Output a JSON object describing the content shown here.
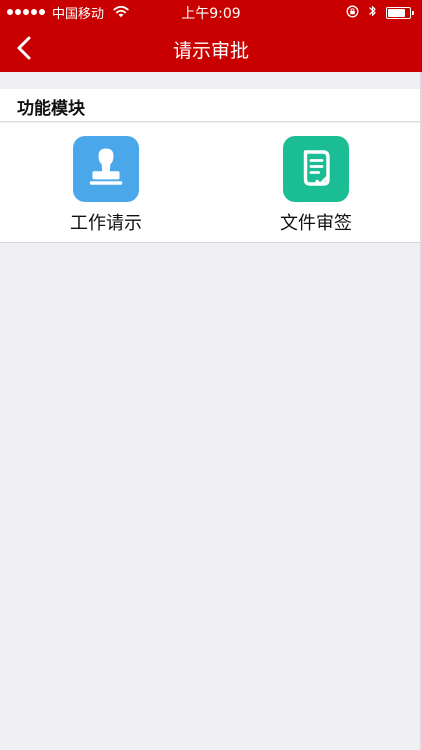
{
  "status_bar": {
    "carrier": "中国移动",
    "time": "上午9:09",
    "battery_level_percent": 88,
    "icons": [
      "signal-dots-icon",
      "wifi-icon",
      "orientation-lock-icon",
      "bluetooth-icon",
      "battery-icon"
    ]
  },
  "nav_bar": {
    "title": "请示审批",
    "back_icon": "chevron-left-icon"
  },
  "section": {
    "title": "功能模块"
  },
  "modules": [
    {
      "label": "工作请示",
      "icon": "stamp-icon",
      "color": "#4aa8ea"
    },
    {
      "label": "文件审签",
      "icon": "document-check-icon",
      "color": "#1bbd94"
    }
  ],
  "colors": {
    "primary": "#c90000",
    "background": "#efeff4",
    "panel": "#ffffff"
  }
}
